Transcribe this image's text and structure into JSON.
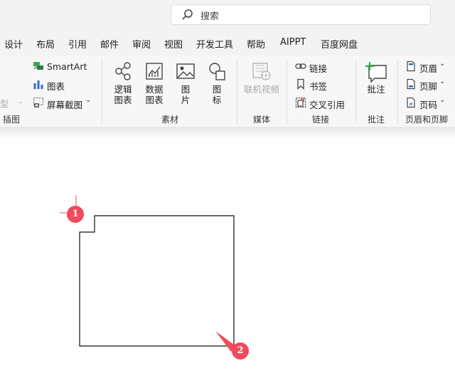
{
  "search": {
    "placeholder": "搜索",
    "icon": "search-icon"
  },
  "menubar": {
    "items": [
      "设计",
      "布局",
      "引用",
      "邮件",
      "审阅",
      "视图",
      "开发工具",
      "帮助",
      "AIPPT",
      "百度网盘"
    ]
  },
  "ribbon": {
    "illustrations": {
      "cut_label": "型",
      "smartart": "SmartArt",
      "chart": "图表",
      "screenshot": "屏幕截图",
      "group_label": "插图"
    },
    "materials": {
      "logic_chart": "逻辑\n图表",
      "data_chart": "数据\n图表",
      "picture": "图\n片",
      "icon": "图\n标",
      "group_label": "素材"
    },
    "media": {
      "online_video": "联机视频",
      "group_label": "媒体"
    },
    "links": {
      "link": "链接",
      "bookmark": "书签",
      "cross_ref": "交叉引用",
      "group_label": "链接"
    },
    "comments": {
      "comment": "批注",
      "group_label": "批注"
    },
    "header_footer": {
      "header": "页眉",
      "footer": "页脚",
      "page_number": "页码",
      "group_label": "页眉和页脚"
    }
  },
  "annotations": {
    "marker1": "1",
    "marker2": "2",
    "marker_color": "#f04a5c"
  }
}
